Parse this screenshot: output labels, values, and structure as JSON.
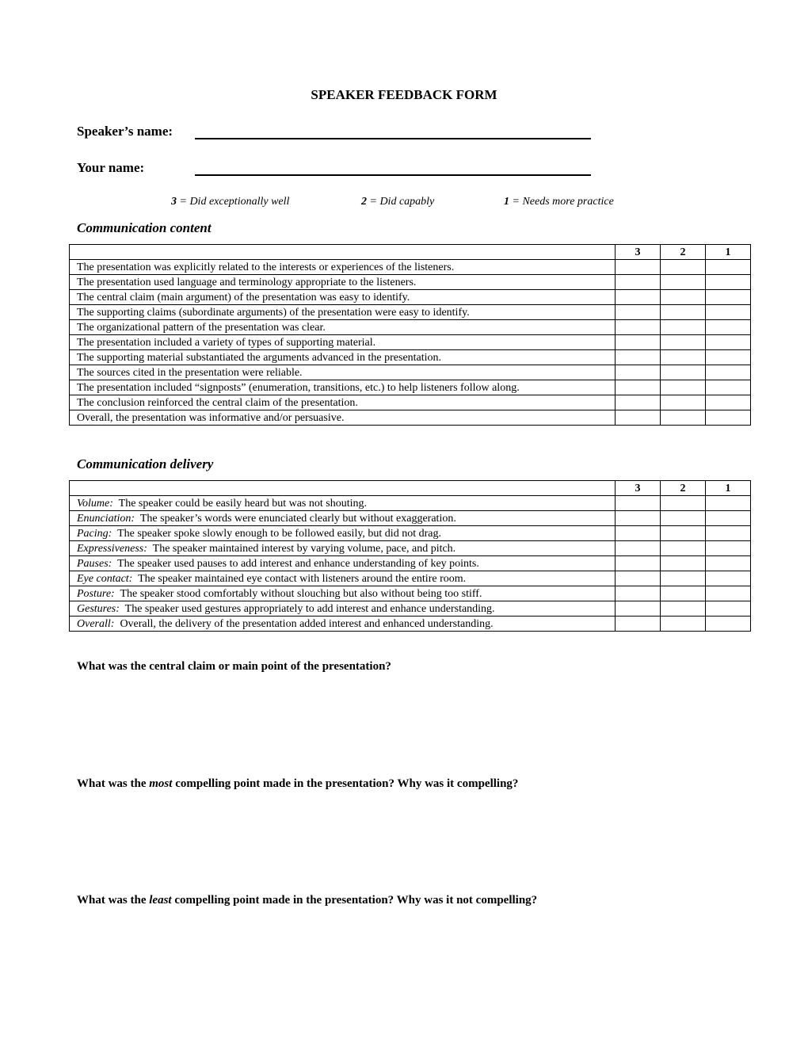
{
  "title": "SPEAKER FEEDBACK FORM",
  "fields": {
    "speaker_name_label": "Speaker’s name:",
    "speaker_name_value": "",
    "your_name_label": "Your name:",
    "your_name_value": ""
  },
  "legend": [
    {
      "score": "3",
      "text": " = Did exceptionally well"
    },
    {
      "score": "2",
      "text": " = Did capably"
    },
    {
      "score": "1",
      "text": " = Needs more practice"
    }
  ],
  "score_columns": [
    "3",
    "2",
    "1"
  ],
  "content_section": {
    "heading": "Communication content",
    "rows": [
      {
        "label": "",
        "text": "The presentation was explicitly related to the interests or experiences of the listeners."
      },
      {
        "label": "",
        "text": "The presentation used language and terminology appropriate to the listeners."
      },
      {
        "label": "",
        "text": "The central claim (main argument) of the presentation was easy to identify."
      },
      {
        "label": "",
        "text": "The supporting claims (subordinate arguments) of the presentation were easy to identify."
      },
      {
        "label": "",
        "text": "The organizational pattern of the presentation was clear."
      },
      {
        "label": "",
        "text": "The presentation included a variety of types of supporting material."
      },
      {
        "label": "",
        "text": "The supporting material substantiated the arguments advanced in the presentation."
      },
      {
        "label": "",
        "text": "The sources cited in the presentation were reliable."
      },
      {
        "label": "",
        "text": "The presentation included “signposts” (enumeration, transitions, etc.) to help listeners follow along."
      },
      {
        "label": "",
        "text": "The conclusion reinforced the central claim of the presentation."
      },
      {
        "label": "",
        "text": "Overall, the presentation was informative and/or persuasive."
      }
    ]
  },
  "delivery_section": {
    "heading": "Communication delivery",
    "rows": [
      {
        "label": "Volume:",
        "text": "  The speaker could be easily heard but was not shouting."
      },
      {
        "label": "Enunciation:",
        "text": "  The speaker’s words were enunciated clearly but without exaggeration."
      },
      {
        "label": "Pacing:",
        "text": "  The speaker spoke slowly enough to be followed easily, but did not drag."
      },
      {
        "label": "Expressiveness:",
        "text": "  The speaker maintained interest by varying volume, pace, and pitch."
      },
      {
        "label": "Pauses:",
        "text": "  The speaker used pauses to add interest and enhance understanding of key points."
      },
      {
        "label": "Eye contact:",
        "text": "  The speaker maintained eye contact with listeners around the entire room."
      },
      {
        "label": "Posture:",
        "text": "  The speaker stood comfortably without slouching but also without being too stiff."
      },
      {
        "label": "Gestures:",
        "text": "  The speaker used gestures appropriately to add interest and enhance understanding."
      },
      {
        "label": "Overall:",
        "text": "  Overall, the delivery of the presentation added interest and enhanced understanding."
      }
    ]
  },
  "questions": [
    {
      "before": "What was the central claim or main point of the presentation?",
      "emphasis": "",
      "after": ""
    },
    {
      "before": "What was the ",
      "emphasis": "most",
      "after": " compelling point made in the presentation?  Why was it compelling?"
    },
    {
      "before": "What was the ",
      "emphasis": "least",
      "after": " compelling point made in the presentation?  Why was it not compelling?"
    }
  ]
}
